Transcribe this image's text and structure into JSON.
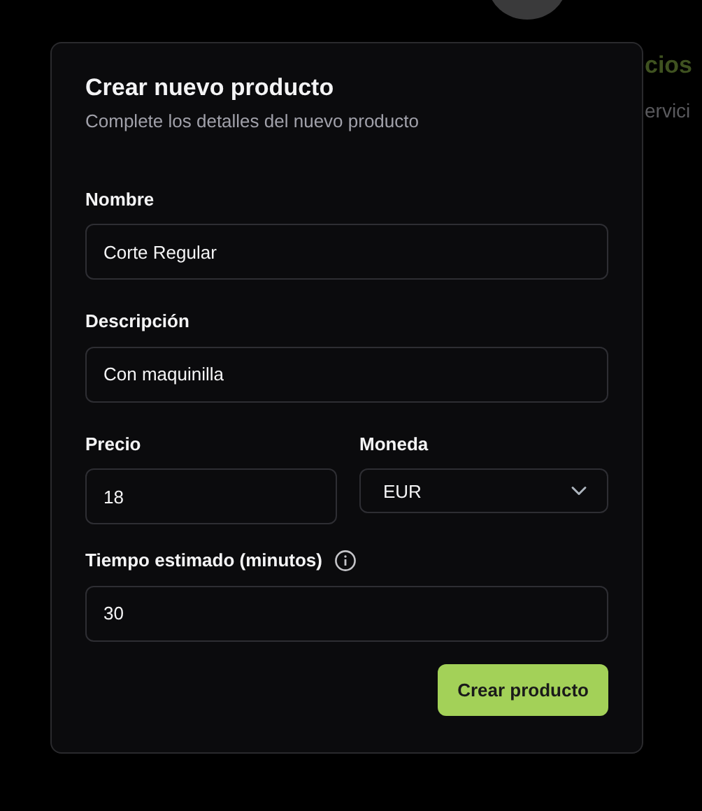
{
  "background": {
    "heading": "cios",
    "subtitle": "ervici"
  },
  "dialog": {
    "title": "Crear nuevo producto",
    "subtitle": "Complete los detalles del nuevo producto",
    "fields": [
      {
        "kind": "text",
        "label": "Nombre",
        "value": "Corte Regular"
      },
      {
        "kind": "text",
        "label": "Descripción",
        "value": "Con maquinilla"
      }
    ],
    "price": {
      "label": "Precio",
      "value": "18"
    },
    "currency": {
      "label": "Moneda",
      "value": "EUR"
    },
    "time": {
      "label": "Tiempo estimado (minutos)",
      "info": true,
      "value": "30"
    },
    "submit": "Crear producto"
  }
}
